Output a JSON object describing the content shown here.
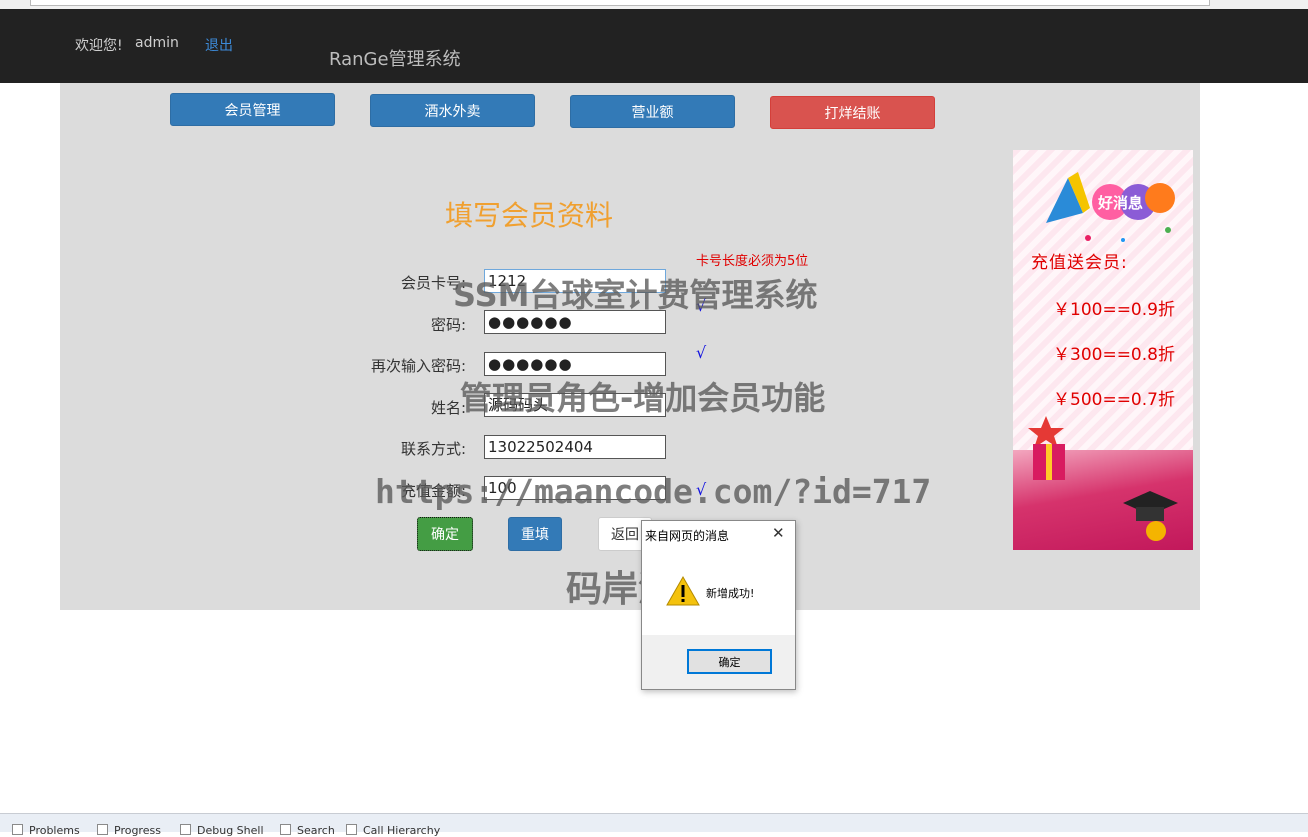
{
  "header": {
    "welcome": "欢迎您!",
    "user": "admin",
    "logout": "退出",
    "brand": "RanGe管理系统"
  },
  "nav": {
    "members": "会员管理",
    "drinks": "酒水外卖",
    "revenue": "营业额",
    "closing": "打烊结账"
  },
  "form": {
    "title": "填写会员资料",
    "card_note": "卡号长度必须为5位",
    "card_label": "会员卡号:",
    "card_value": "1212",
    "password_label": "密码:",
    "password_value": "●●●●●●",
    "password_check": "√",
    "confirm_label": "再次输入密码:",
    "confirm_value": "●●●●●●",
    "confirm_check": "√",
    "name_label": "姓名:",
    "name_value": "源码码头",
    "phone_label": "联系方式:",
    "phone_value": "13022502404",
    "amount_label": "充值金额:",
    "amount_value": "100",
    "amount_check": "√",
    "submit": "确定",
    "reset": "重填",
    "back": "返回"
  },
  "ad": {
    "badge": "好消息",
    "heading": "充值送会员:",
    "lines": [
      "￥100==0.9折",
      "￥300==0.8折",
      "￥500==0.7折"
    ],
    "colors": {
      "text": "#e00000",
      "bottom": "#c2185b"
    }
  },
  "watermarks": {
    "line1": "SSM台球室计费管理系统",
    "line2": "管理员角色-增加会员功能",
    "line3": "https://maancode.com/?id=717",
    "line4": "码岸源码"
  },
  "dialog": {
    "title": "来自网页的消息",
    "close": "✕",
    "message": "新增成功!",
    "ok": "确定",
    "icon": "warning-icon"
  },
  "bottom_tabs": [
    "Problems",
    "Progress",
    "Debug Shell",
    "Search",
    "Call Hierarchy"
  ],
  "colors": {
    "header_bg": "#222222",
    "panel_bg": "#dcdcdc",
    "primary": "#337ab7",
    "danger": "#d9534f",
    "success": "#449d44",
    "title": "#f0a030"
  }
}
